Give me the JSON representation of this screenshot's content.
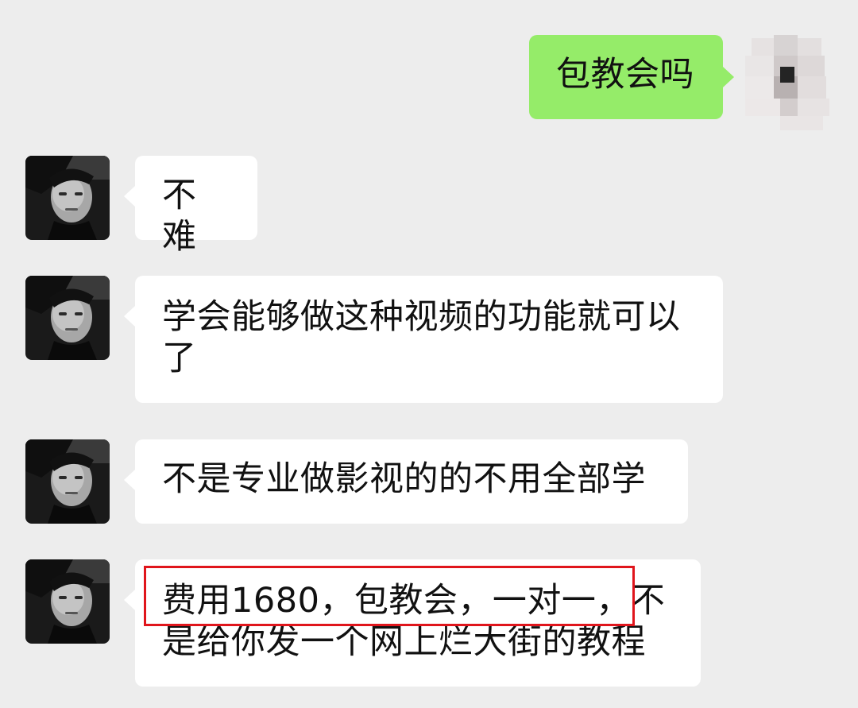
{
  "chat": {
    "messages": [
      {
        "sender": "self",
        "avatar": "pixelated-avatar-icon",
        "text": "包教会吗"
      },
      {
        "sender": "contact",
        "avatar": "portrait-avatar-icon",
        "text": "不难"
      },
      {
        "sender": "contact",
        "avatar": "portrait-avatar-icon",
        "text": "学会能够做这种视频的功能就可以了"
      },
      {
        "sender": "contact",
        "avatar": "portrait-avatar-icon",
        "text": "不是专业做影视的的不用全部学"
      },
      {
        "sender": "contact",
        "avatar": "portrait-avatar-icon",
        "text": "费用1680，包教会，一对一，不是给你发一个网上烂大街的教程"
      }
    ]
  },
  "theme": {
    "background": "#ededed",
    "incoming_bubble": "#ffffff",
    "outgoing_bubble": "#95ec69",
    "highlight": "#e0151c"
  }
}
